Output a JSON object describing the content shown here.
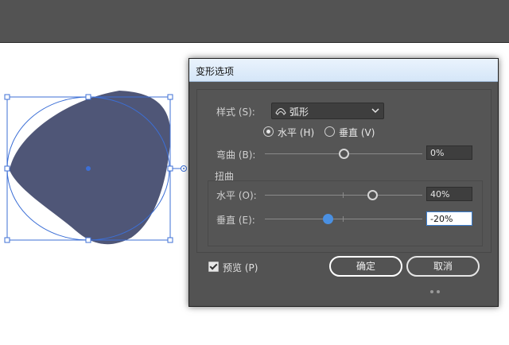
{
  "dialog": {
    "title": "变形选项",
    "style_label": "样式 (S):",
    "style_value": "弧形",
    "orientation": {
      "horizontal_label": "水平 (H)",
      "vertical_label": "垂直 (V)",
      "selected": "horizontal"
    },
    "bend": {
      "label": "弯曲 (B):",
      "value": "0%",
      "level": 0
    },
    "distortion": {
      "heading": "扭曲",
      "horizontal": {
        "label": "水平 (O):",
        "value": "40%",
        "level": 40
      },
      "vertical": {
        "label": "垂直 (E):",
        "value": "-20%",
        "level": -20
      }
    },
    "preview": {
      "label": "预览 (P)",
      "checked": true
    },
    "ok_label": "确定",
    "cancel_label": "取消"
  },
  "colors": {
    "shape_fill": "#4f5677",
    "selection": "#3c6fd6",
    "dialog_bg": "#535353",
    "titlebar": "#dbe9f8"
  },
  "icons": [
    "arc-style-icon",
    "chevron-down-icon",
    "checkbox-check-icon",
    "resize-grip-icon"
  ]
}
